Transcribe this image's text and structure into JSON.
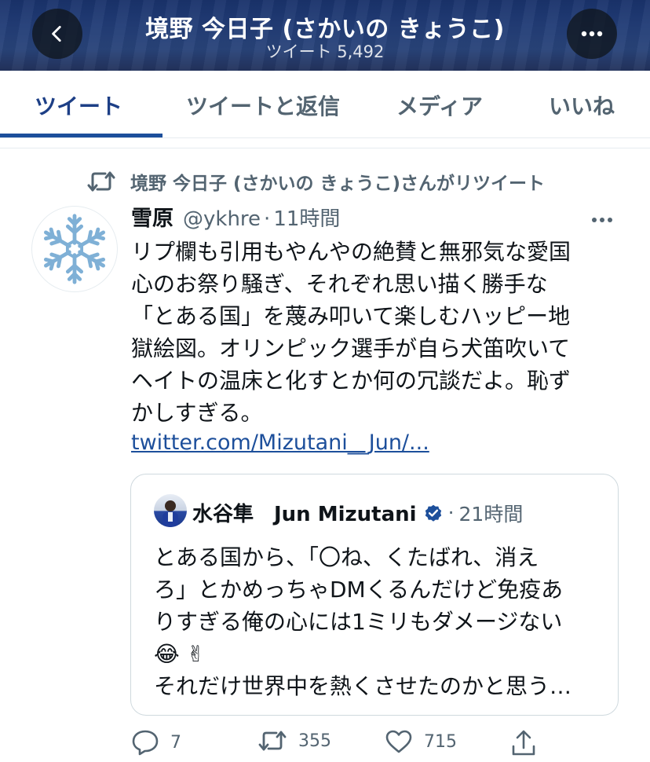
{
  "header": {
    "title": "境野 今日子 (さかいの きょうこ)",
    "subtitle": "ツイート 5,492",
    "back_icon": "chevron-left-icon",
    "more_icon": "more-horizontal-icon"
  },
  "tabs": [
    {
      "label": "ツイート",
      "active": true
    },
    {
      "label": "ツイートと返信",
      "active": false
    },
    {
      "label": "メディア",
      "active": false
    },
    {
      "label": "いいね",
      "active": false
    }
  ],
  "retweet_notice": "境野 今日子 (さかいの きょうこ)さんがリツイート",
  "tweet": {
    "display_name": "雪原",
    "handle": "@ykhre",
    "separator": "·",
    "time": "11時間",
    "avatar_icon": "snowflake-icon",
    "text_lines": [
      "リプ欄も引用もやんやの絶賛と無邪気な愛国",
      "心のお祭り騒ぎ、それぞれ思い描く勝手な",
      "「とある国」を蔑み叩いて楽しむハッピー地",
      "獄絵図。オリンピック選手が自ら犬笛吹いて",
      "ヘイトの温床と化すとか何の冗談だよ。恥ず",
      "かしすぎる。"
    ],
    "link": "twitter.com/Mizutani__Jun/..."
  },
  "quote": {
    "display_name": "水谷隼　Jun Mizutani",
    "separator": "·",
    "time": "21時間",
    "text_lines": [
      "とある国から、「〇ね、くたばれ、消え",
      "ろ」とかめっちゃDMくるんだけど免疫あ",
      "りすぎる俺の心には1ミリもダメージない",
      "😂 ✌",
      "それだけ世界中を熱くさせたのかと思う…"
    ]
  },
  "actions": {
    "replies": "7",
    "retweets": "355",
    "likes": "715"
  },
  "colors": {
    "accent": "#1d4f9b",
    "muted": "#536471",
    "verified": "#1d4f9b"
  }
}
